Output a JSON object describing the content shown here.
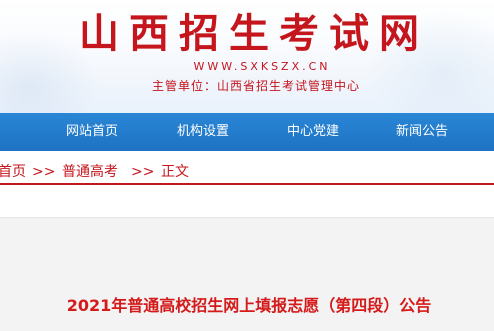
{
  "header": {
    "site_title": "山西招生考试网",
    "url": "WWW.SXKSZX.CN",
    "sponsor": "主管单位：山西省招生考试管理中心"
  },
  "nav": {
    "items": [
      {
        "label": "网站首页"
      },
      {
        "label": "机构设置"
      },
      {
        "label": "中心党建"
      },
      {
        "label": "新闻公告"
      }
    ]
  },
  "breadcrumb": {
    "items": [
      "首页",
      "普通高考",
      "正文"
    ],
    "separator": ">>"
  },
  "article": {
    "title": "2021年普通高校招生网上填报志愿（第四段）公告"
  },
  "colors": {
    "brand_red": "#c4161c",
    "nav_blue": "#1d72c3",
    "title_red": "#d41a1a"
  }
}
